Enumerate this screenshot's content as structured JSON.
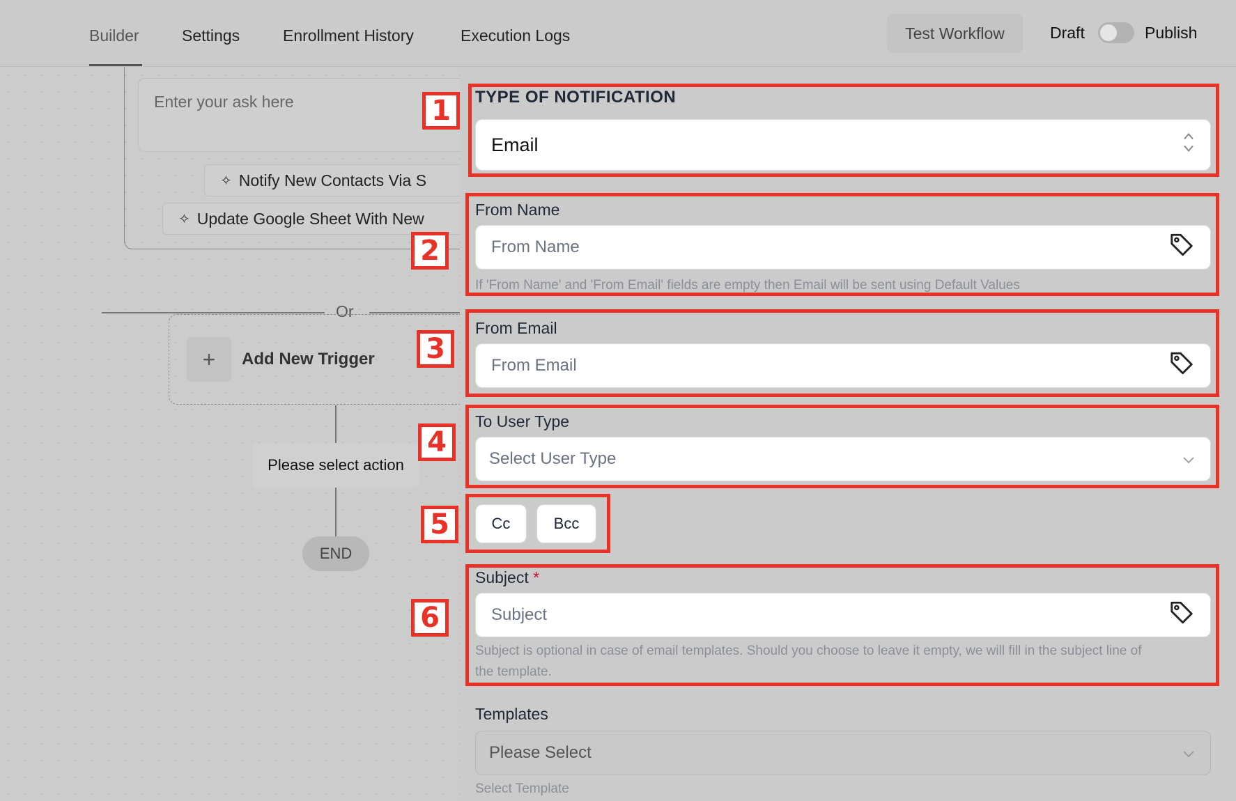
{
  "tabs": [
    {
      "label": "Builder",
      "active": true
    },
    {
      "label": "Settings"
    },
    {
      "label": "Enrollment History"
    },
    {
      "label": "Execution Logs"
    }
  ],
  "header": {
    "test_workflow": "Test Workflow",
    "draft_label": "Draft",
    "publish_label": "Publish",
    "publish_toggle_on": false
  },
  "builder": {
    "ask_placeholder": "Enter your ask here",
    "suggestions": [
      "Notify New Contacts Via S",
      "Update Google Sheet With New"
    ],
    "or_label": "Or",
    "add_trigger": "Add New Trigger",
    "select_action": "Please select action",
    "end_label": "END"
  },
  "form": {
    "type_of_notification": {
      "label": "TYPE OF NOTIFICATION",
      "value": "Email"
    },
    "from_name": {
      "label": "From Name",
      "placeholder": "From Name",
      "help": "If 'From Name' and 'From Email' fields are empty then Email will be sent using Default Values"
    },
    "from_email": {
      "label": "From Email",
      "placeholder": "From Email"
    },
    "to_user_type": {
      "label": "To User Type",
      "placeholder": "Select User Type"
    },
    "cc_label": "Cc",
    "bcc_label": "Bcc",
    "subject": {
      "label": "Subject",
      "required_mark": "*",
      "placeholder": "Subject",
      "help_line1": "Subject is optional in case of email templates. Should you choose to leave it empty, we will fill in the subject line of",
      "help_line2": "the template."
    },
    "templates": {
      "label": "Templates",
      "placeholder": "Please Select",
      "help": "Select Template"
    }
  },
  "annotations": [
    "1",
    "2",
    "3",
    "4",
    "5",
    "6"
  ],
  "colors": {
    "annotation_red": "#e83228",
    "canvas_gray": "#cbcbcb"
  }
}
